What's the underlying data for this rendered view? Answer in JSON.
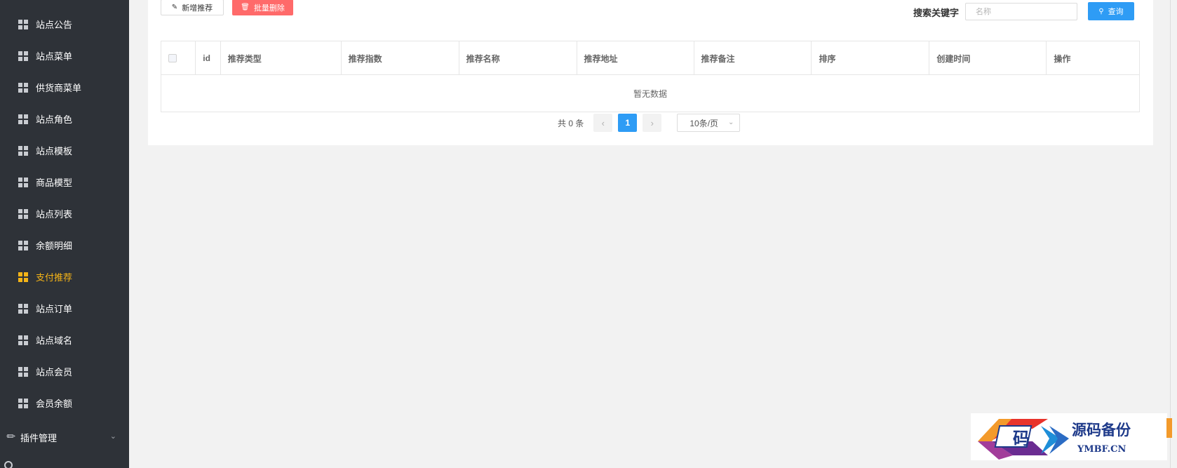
{
  "sidebar": {
    "items": [
      {
        "label": "站点公告",
        "active": false
      },
      {
        "label": "站点菜单",
        "active": false
      },
      {
        "label": "供货商菜单",
        "active": false
      },
      {
        "label": "站点角色",
        "active": false
      },
      {
        "label": "站点模板",
        "active": false
      },
      {
        "label": "商品模型",
        "active": false
      },
      {
        "label": "站点列表",
        "active": false
      },
      {
        "label": "余额明细",
        "active": false
      },
      {
        "label": "支付推荐",
        "active": true
      },
      {
        "label": "站点订单",
        "active": false
      },
      {
        "label": "站点域名",
        "active": false
      },
      {
        "label": "站点会员",
        "active": false
      },
      {
        "label": "会员余额",
        "active": false
      }
    ],
    "group": {
      "label": "插件管理",
      "icon": "plug-icon"
    }
  },
  "toolbar": {
    "add_label": "新增推荐",
    "delete_label": "批量删除",
    "search_label": "搜索关键字",
    "search_placeholder": "名称",
    "query_label": "查询"
  },
  "table": {
    "columns": [
      "id",
      "推荐类型",
      "推荐指数",
      "推荐名称",
      "推荐地址",
      "推荐备注",
      "排序",
      "创建时间",
      "操作"
    ],
    "empty_text": "暂无数据"
  },
  "pager": {
    "total_text": "共 0 条",
    "current_page": "1",
    "page_size": "10条/页"
  },
  "watermark": {
    "logo_char": "码",
    "title": "源码备份",
    "subtitle": "YMBF.CN"
  },
  "colors": {
    "sidebar_bg": "#2e3238",
    "active": "#f5b417",
    "primary": "#2e9cf5",
    "danger": "#ff6a6a"
  }
}
